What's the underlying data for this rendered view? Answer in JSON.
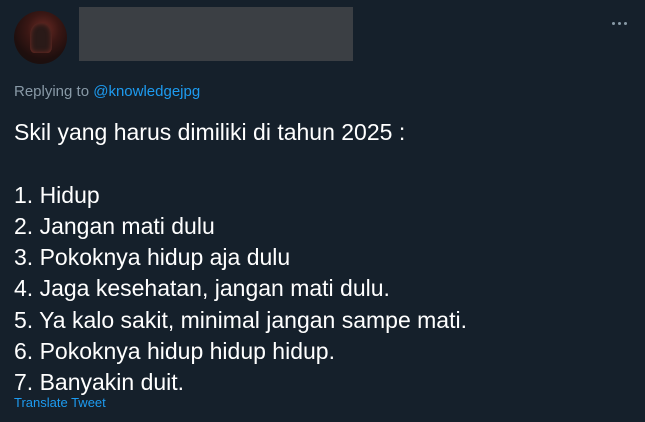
{
  "tweet": {
    "replying_prefix": "Replying to",
    "replying_handle": "@knowledgejpg",
    "lines": [
      "Skil yang harus dimiliki di tahun 2025 :",
      "1. Hidup",
      "2. Jangan mati dulu",
      "3. Pokoknya hidup aja dulu",
      "4. Jaga kesehatan, jangan mati dulu.",
      "5. Ya kalo sakit, minimal jangan sampe mati.",
      "6. Pokoknya hidup hidup hidup.",
      "7. Banyakin duit."
    ],
    "translate_label": "Translate Tweet",
    "more_icon": "more-horizontal-icon"
  },
  "colors": {
    "background": "#15202b",
    "text": "#ffffff",
    "secondary": "#8899a6",
    "link": "#1d9bf0"
  }
}
